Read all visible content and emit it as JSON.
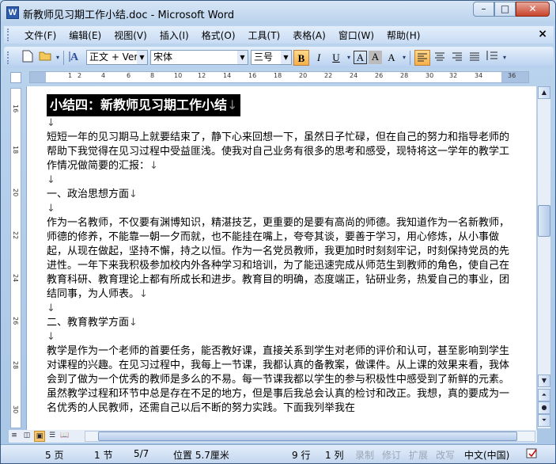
{
  "window": {
    "title": "新教师见习期工作小结.doc - Microsoft Word",
    "icon": "W",
    "buttons": {
      "minimize": "–",
      "maximize": "□",
      "close": "✕"
    }
  },
  "menu": {
    "items": [
      "文件(F)",
      "编辑(E)",
      "视图(V)",
      "插入(I)",
      "格式(O)",
      "工具(T)",
      "表格(A)",
      "窗口(W)",
      "帮助(H)"
    ],
    "close": "×"
  },
  "toolbar": {
    "style_value": "正文 + Ver",
    "font_value": "宋体",
    "size_value": "三号",
    "bold": "B",
    "italic": "I",
    "underline": "U",
    "char_border": "A",
    "char_shading": "A",
    "highlight": "A"
  },
  "ruler": {
    "labels": [
      "1",
      "2",
      "4",
      "6",
      "8",
      "10",
      "12",
      "14",
      "16",
      "18",
      "20",
      "22",
      "24",
      "26",
      "28",
      "30",
      "32",
      "34",
      "36"
    ],
    "vlabels": [
      "16",
      "18",
      "20",
      "22",
      "24",
      "26",
      "28",
      "30"
    ]
  },
  "document": {
    "heading": "小结四：新教师见习期工作小结",
    "para_mark": "↓",
    "intro": "短短一年的见习期马上就要结束了，静下心来回想一下，虽然日子忙碌，但在自己的努力和指导老师的帮助下我觉得在见习过程中受益匪浅。使我对自己业务有很多的思考和感受，现特将这一学年的教学工作情况做简要的汇报：",
    "section1": "一、政治思想方面",
    "para1": "作为一名教师，不仅要有渊博知识，精湛技艺，更重要的是要有高尚的师德。我知道作为一名新教师，师德的修养，不能靠一朝一夕而就，也不能挂在嘴上，夸夸其谈，要善于学习，用心修炼，从小事做起，从现在做起，坚持不懈，持之以恒。作为一名党员教师，我更加时时刻刻牢记，时刻保持党员的先进性。一年下来我积极参加校内外各种学习和培训，为了能迅速完成从师范生到教师的角色，使自己在教育科研、教育理论上都有所成长和进步。教育目的明确，态度端正，钻研业务，热爱自己的事业，团结同事，为人师表。",
    "section2": "二、教育教学方面",
    "para2": "教学是作为一个老师的首要任务，能否教好课，直接关系到学生对老师的评价和认可，甚至影响到学生对课程的兴趣。在见习过程中，我每上一节课，我都认真的备教案，做课件。从上课的效果来看，我体会到了做为一个优秀的教师是多么的不易。每一节课我都以学生的参与积极性中感受到了新鲜的元素。虽然教学过程和环节中总是存在不足的地方，但是事后我总会认真的检讨和改正。我想，真的要成为一名优秀的人民教师，还需自己以后不断的努力实践。下面我列举我在"
  },
  "status": {
    "page": "5 页",
    "section": "1 节",
    "pages": "5/7",
    "position": "位置 5.7厘米",
    "line": "9 行",
    "column": "1 列",
    "rec": "录制",
    "trk": "修订",
    "ext": "扩展",
    "ovr": "改写",
    "lang": "中文(中国)"
  },
  "colors": {
    "titlebar": "#c9dcf2",
    "menubar": "#d6e5f8",
    "highlight_active": "#f5b04a",
    "document_bg": "#ffffff"
  }
}
